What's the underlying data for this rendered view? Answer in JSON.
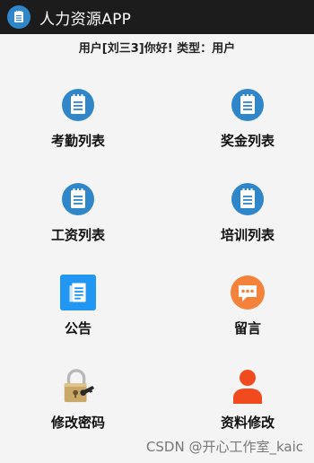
{
  "app": {
    "title": "人力资源APP"
  },
  "greeting": "用户[刘三3]你好! 类型：用户",
  "menu": [
    {
      "label": "考勤列表",
      "icon": "notepad-icon"
    },
    {
      "label": "奖金列表",
      "icon": "notepad-icon"
    },
    {
      "label": "工资列表",
      "icon": "notepad-icon"
    },
    {
      "label": "培训列表",
      "icon": "notepad-icon"
    },
    {
      "label": "公告",
      "icon": "document-icon"
    },
    {
      "label": "留言",
      "icon": "chat-icon"
    },
    {
      "label": "修改密码",
      "icon": "padlock-key-icon"
    },
    {
      "label": "资料修改",
      "icon": "user-icon"
    }
  ],
  "watermark": "CSDN @开心工作室_kaic",
  "colors": {
    "titlebar": "#1c1c1c",
    "notepad_blue": "#2f86c9",
    "document_blue": "#2196f3",
    "chat_orange": "#f5823a",
    "user_red": "#f04a1e"
  }
}
